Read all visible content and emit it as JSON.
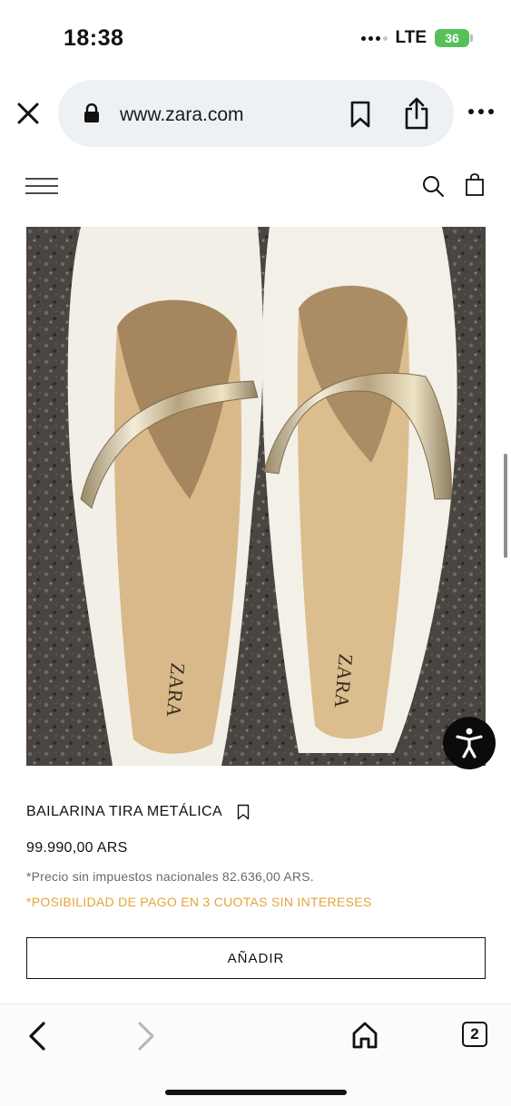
{
  "status_bar": {
    "time": "18:38",
    "network": "LTE",
    "battery": "36"
  },
  "browser": {
    "url": "www.zara.com",
    "icons": [
      "close-icon",
      "lock-icon",
      "bookmark-icon",
      "share-icon",
      "more-icon"
    ]
  },
  "site_header": {
    "icons": [
      "menu-icon",
      "search-icon",
      "shopping-bag-icon"
    ]
  },
  "product": {
    "image_icon": "product-photo",
    "name": "BAILARINA TIRA METÁLICA",
    "price": "99.990,00 ARS",
    "tax_note": "*Precio sin impuestos nacionales 82.636,00 ARS.",
    "promo_note": "*POSIBILIDAD DE PAGO EN 3 CUOTAS SIN INTERESES",
    "add_label": "AÑADIR",
    "brand_print": "ZARA"
  },
  "toolbar": {
    "tabs_count": "2",
    "icons": [
      "back-icon",
      "forward-icon",
      "home-icon",
      "tabs-icon"
    ]
  },
  "colors": {
    "promo": "#e3a43a",
    "battery": "#58c05b",
    "url_pill": "#eef1f4"
  }
}
